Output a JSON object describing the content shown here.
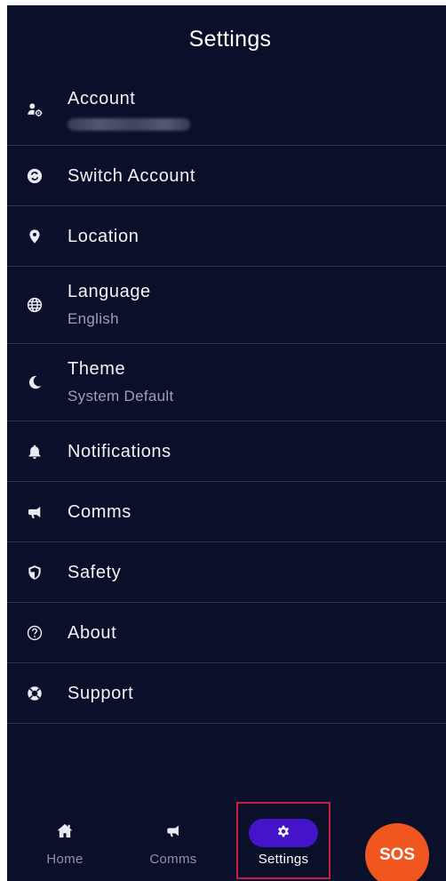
{
  "header": {
    "title": "Settings"
  },
  "menu": {
    "items": [
      {
        "label": "Account",
        "sub": "",
        "icon": "account-gear-icon"
      },
      {
        "label": "Switch Account",
        "icon": "switch-account-icon"
      },
      {
        "label": "Location",
        "icon": "location-pin-icon"
      },
      {
        "label": "Language",
        "sub": "English",
        "icon": "globe-icon"
      },
      {
        "label": "Theme",
        "sub": "System Default",
        "icon": "moon-icon"
      },
      {
        "label": "Notifications",
        "icon": "bell-icon"
      },
      {
        "label": "Comms",
        "icon": "megaphone-icon"
      },
      {
        "label": "Safety",
        "icon": "shield-icon"
      },
      {
        "label": "About",
        "icon": "question-circle-icon"
      },
      {
        "label": "Support",
        "icon": "lifebuoy-icon"
      }
    ]
  },
  "bottom_nav": {
    "items": [
      {
        "label": "Home",
        "icon": "home-icon"
      },
      {
        "label": "Comms",
        "icon": "megaphone-icon"
      },
      {
        "label": "Settings",
        "icon": "gear-icon",
        "active": true
      }
    ],
    "sos_label": "SOS"
  },
  "colors": {
    "background": "#0a1029",
    "divider": "#2b3350",
    "active_pill": "#4414c8",
    "sos": "#f0561e",
    "highlight_box": "#c8203c"
  }
}
